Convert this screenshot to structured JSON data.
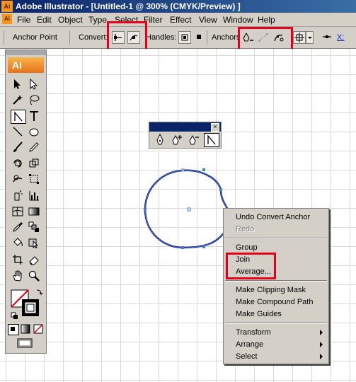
{
  "window": {
    "title": "Adobe Illustrator - [Untitled-1 @ 300% (CMYK/Preview) ]",
    "app_icon": "Ai"
  },
  "menubar": {
    "items": [
      "File",
      "Edit",
      "Object",
      "Type",
      "Select",
      "Filter",
      "Effect",
      "View",
      "Window",
      "Help"
    ]
  },
  "control_panel": {
    "context_label": "Anchor Point",
    "convert_label": "Convert:",
    "handles_label": "Handles:",
    "anchors_label": "Anchors",
    "x_label": "X:"
  },
  "toolbox": {
    "logo": "Ai"
  },
  "context_menu": {
    "items": [
      "Undo Convert Anchor",
      "Redo",
      "Group",
      "Join",
      "Average...",
      "Make Clipping Mask",
      "Make Compound Path",
      "Make Guides",
      "Transform",
      "Arrange",
      "Select"
    ],
    "disabled": [
      "Redo"
    ],
    "submenus": [
      "Transform",
      "Arrange",
      "Select"
    ]
  },
  "colors": {
    "highlight": "#e2001a",
    "title_bar": "#0a246a",
    "panel": "#d4d0c8",
    "path": "#1a237e"
  }
}
